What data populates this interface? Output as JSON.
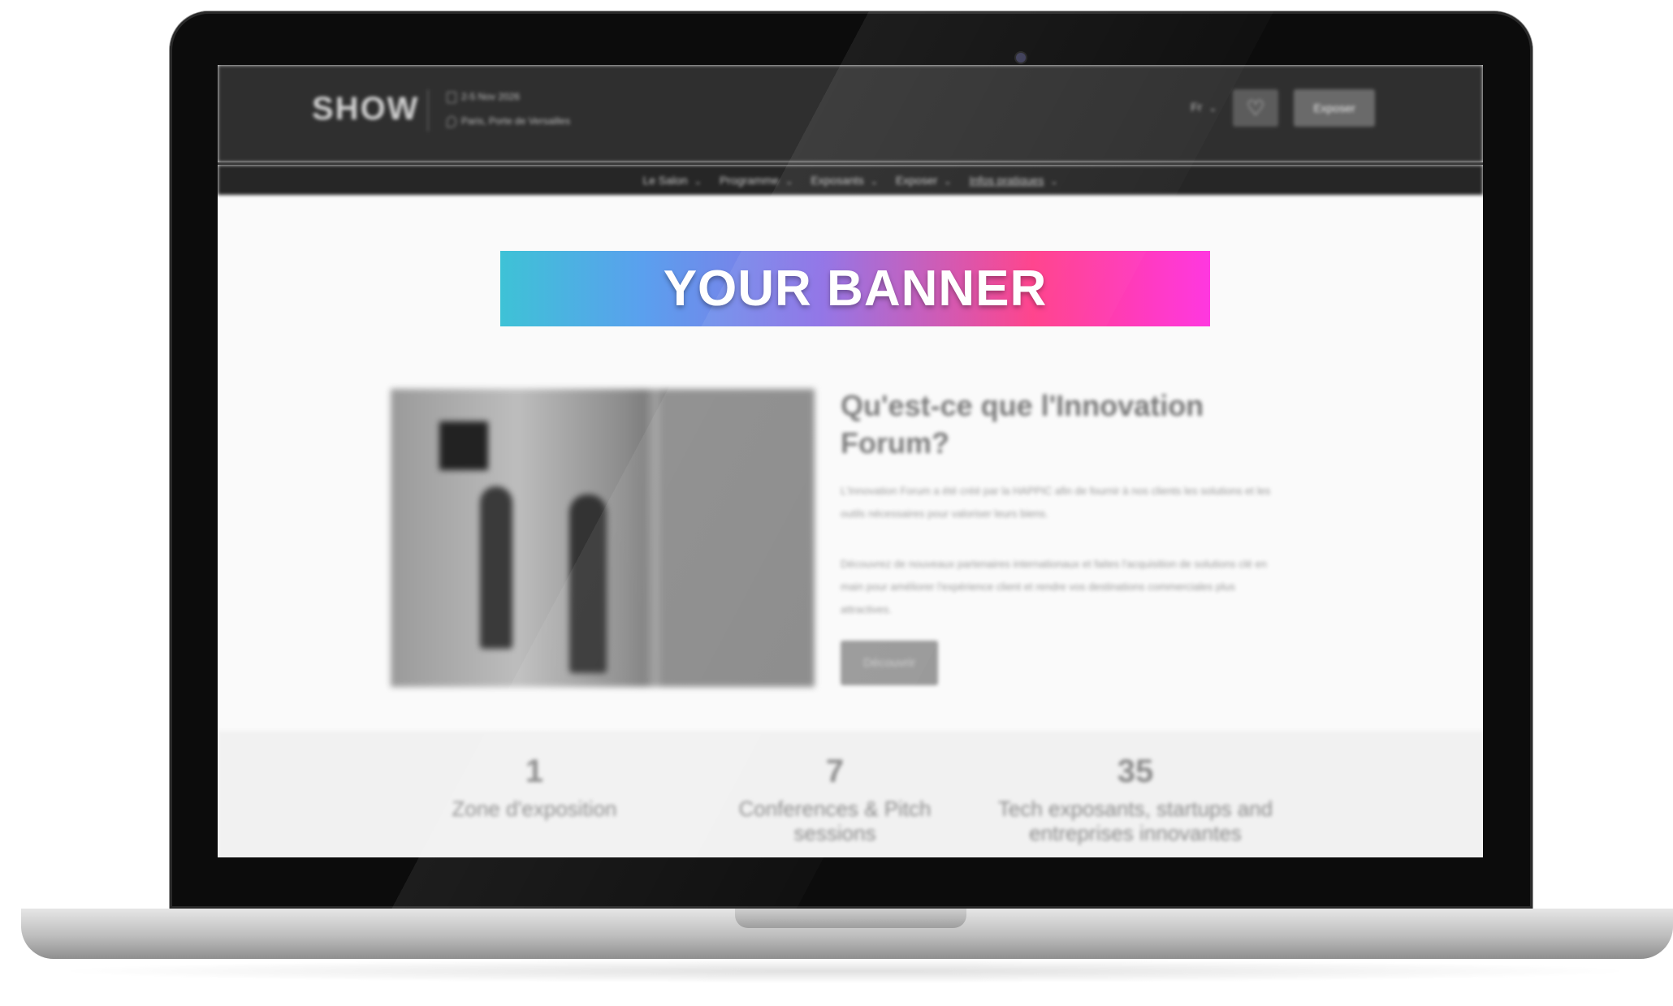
{
  "header": {
    "logo": "SHOW",
    "event_date": "2-5 Nov 2026",
    "event_place": "Paris, Porte de Versailles",
    "lang": "Fr",
    "cta_label": "Exposer"
  },
  "nav": {
    "items": [
      {
        "label": "Le Salon"
      },
      {
        "label": "Programme"
      },
      {
        "label": "Exposants"
      },
      {
        "label": "Exposer"
      },
      {
        "label": "Infos pratiques"
      }
    ]
  },
  "banner": {
    "text": "YOUR BANNER"
  },
  "article": {
    "title": "Qu'est-ce que l'Innovation Forum?",
    "paragraph_1": "L'Innovation Forum a été créé par la HAPPIC afin de fournir à nos clients les solutions et les outils nécessaires pour valoriser leurs biens.",
    "paragraph_2": "Découvrez de nouveaux partenaires internationaux et faites l'acquisition de solutions clé en main pour améliorer l'expérience client et rendre vos destinations commerciales plus attractives.",
    "button_label": "Découvrir"
  },
  "stats": [
    {
      "number": "1",
      "label": "Zone d'exposition"
    },
    {
      "number": "7",
      "label": "Conferences & Pitch sessions"
    },
    {
      "number": "35",
      "label": "Tech exposants, startups and entreprises innovantes"
    }
  ],
  "icons": {
    "calendar": "calendar-icon",
    "location": "location-pin-icon",
    "favorite": "heart-icon",
    "chevron": "chevron-down-icon"
  }
}
